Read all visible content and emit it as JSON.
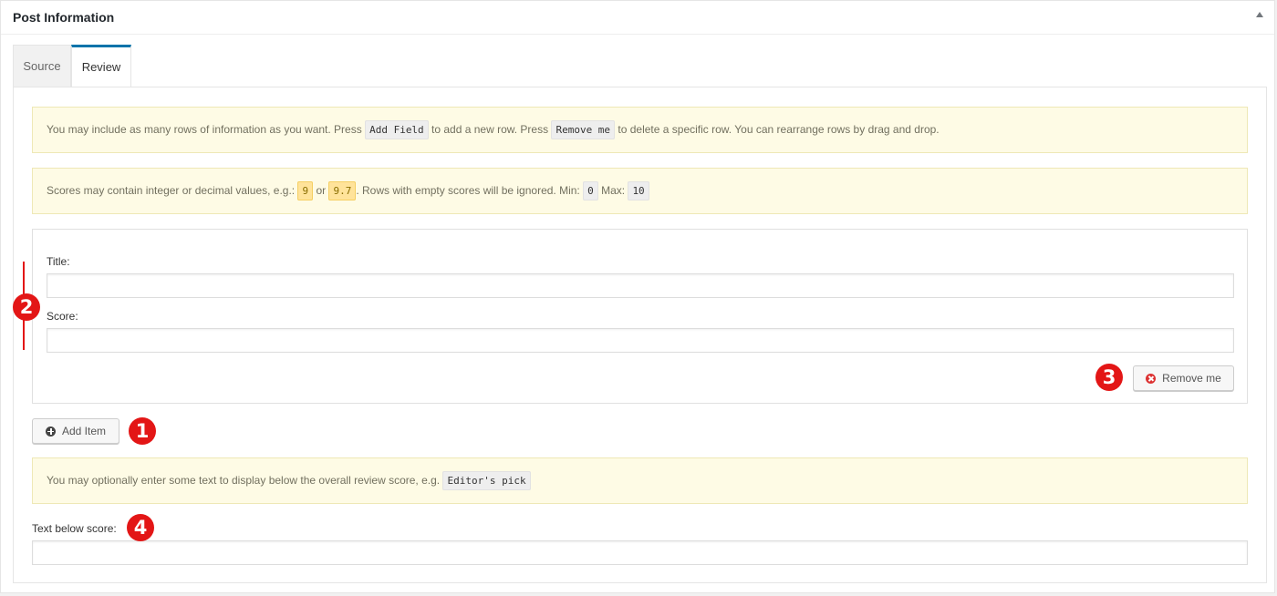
{
  "metabox": {
    "title": "Post Information"
  },
  "tabs": [
    {
      "label": "Source",
      "active": false
    },
    {
      "label": "Review",
      "active": true
    }
  ],
  "notices": {
    "rows": {
      "text_1": "You may include as many rows of information as you want. Press",
      "code_add": "Add Field",
      "text_2": "to add a new row. Press",
      "code_remove": "Remove me",
      "text_3": "to delete a specific row. You can rearrange rows by drag and drop."
    },
    "scores": {
      "text_1": "Scores may contain integer or decimal values, e.g.:",
      "example_1": "9",
      "text_or": "or",
      "example_2": "9.7",
      "text_2": ". Rows with empty scores will be ignored. Min:",
      "min": "0",
      "text_max": "Max:",
      "max": "10"
    },
    "below": {
      "text": "You may optionally enter some text to display below the overall review score, e.g.",
      "code": "Editor's pick"
    }
  },
  "item": {
    "title_label": "Title:",
    "title_value": "",
    "score_label": "Score:",
    "score_value": "",
    "remove_label": "Remove me"
  },
  "add_item_label": "Add Item",
  "text_below": {
    "label": "Text below score:",
    "value": ""
  },
  "markers": [
    "1",
    "2",
    "3",
    "4"
  ],
  "colors": {
    "accent": "#0073aa",
    "marker": "#e31616",
    "notice_bg": "#fefbe5"
  }
}
